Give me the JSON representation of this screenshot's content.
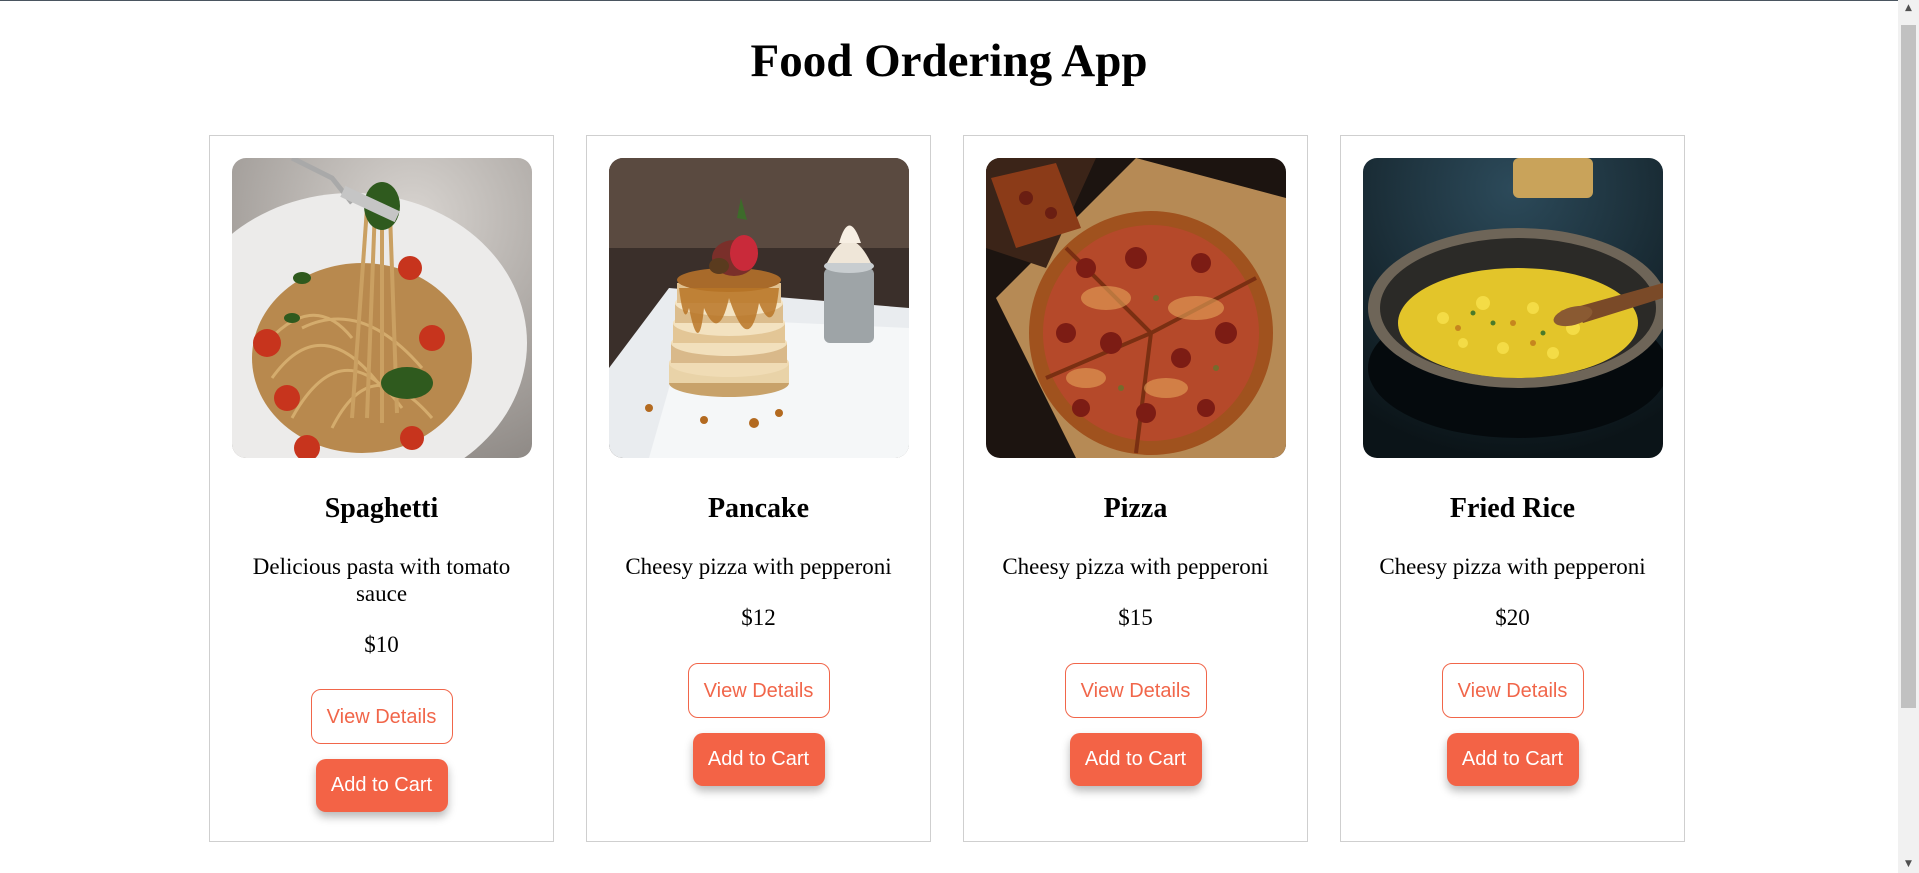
{
  "app": {
    "title": "Food Ordering App"
  },
  "items": [
    {
      "name": "Spaghetti",
      "description": "Delicious pasta with tomato sauce",
      "price": "$10",
      "image_icon": "spaghetti-photo",
      "details_label": "View Details",
      "cart_label": "Add to Cart"
    },
    {
      "name": "Pancake",
      "description": "Cheesy pizza with pepperoni",
      "price": "$12",
      "image_icon": "pancake-photo",
      "details_label": "View Details",
      "cart_label": "Add to Cart"
    },
    {
      "name": "Pizza",
      "description": "Cheesy pizza with pepperoni",
      "price": "$15",
      "image_icon": "pizza-photo",
      "details_label": "View Details",
      "cart_label": "Add to Cart"
    },
    {
      "name": "Fried Rice",
      "description": "Cheesy pizza with pepperoni",
      "price": "$20",
      "image_icon": "fried-rice-photo",
      "details_label": "View Details",
      "cart_label": "Add to Cart"
    }
  ],
  "colors": {
    "accent": "#f36346",
    "accent_border": "#f1664a",
    "card_border": "#cfcfcf"
  }
}
